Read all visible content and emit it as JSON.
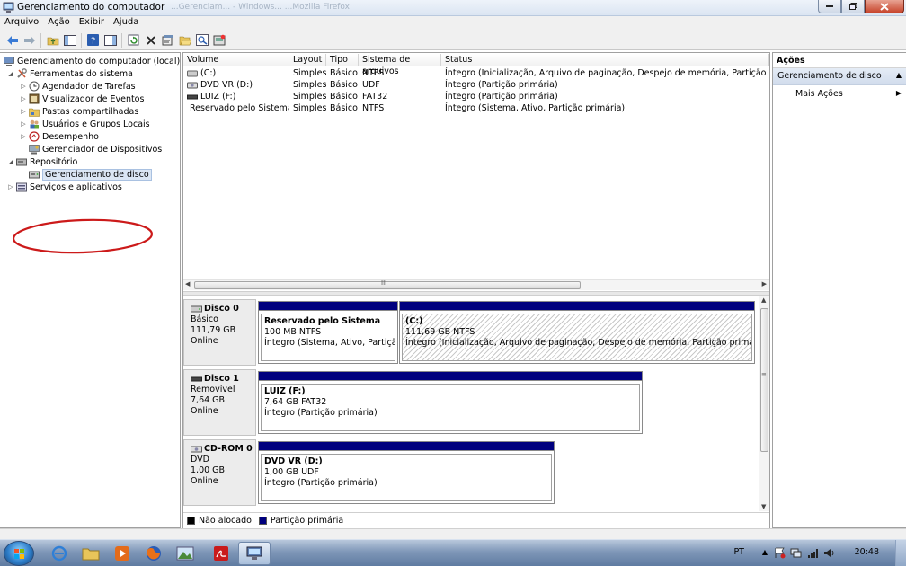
{
  "window": {
    "title": "Gerenciamento do computador",
    "ghost_title": "...Gerenciam... - Windows... ...Mozilla Firefox"
  },
  "menu": [
    "Arquivo",
    "Ação",
    "Exibir",
    "Ajuda"
  ],
  "tree": {
    "root": "Gerenciamento do computador (local)",
    "system_tools": "Ferramentas do sistema",
    "task_scheduler": "Agendador de Tarefas",
    "event_viewer": "Visualizador de Eventos",
    "shared_folders": "Pastas compartilhadas",
    "users_groups": "Usuários e Grupos Locais",
    "performance": "Desempenho",
    "device_manager": "Gerenciador de Dispositivos",
    "storage": "Repositório",
    "disk_management": "Gerenciamento de disco",
    "services_apps": "Serviços e aplicativos"
  },
  "volume_table": {
    "columns": [
      "Volume",
      "Layout",
      "Tipo",
      "Sistema de arquivos",
      "Status"
    ],
    "rows": [
      {
        "volume": "(C:)",
        "layout": "Simples",
        "tipo": "Básico",
        "fs": "NTFS",
        "status": "Íntegro (Inicialização, Arquivo de paginação, Despejo de memória, Partição primária)"
      },
      {
        "volume": "DVD VR (D:)",
        "layout": "Simples",
        "tipo": "Básico",
        "fs": "UDF",
        "status": "Íntegro (Partição primária)"
      },
      {
        "volume": "LUIZ (F:)",
        "layout": "Simples",
        "tipo": "Básico",
        "fs": "FAT32",
        "status": "Íntegro (Partição primária)"
      },
      {
        "volume": "Reservado pelo Sistema",
        "layout": "Simples",
        "tipo": "Básico",
        "fs": "NTFS",
        "status": "Íntegro (Sistema, Ativo, Partição primária)"
      }
    ]
  },
  "scroll_grip": "III",
  "disks": [
    {
      "name": "Disco 0",
      "type": "Básico",
      "size": "111,79 GB",
      "state": "Online",
      "partitions": [
        {
          "name": "Reservado pelo Sistema",
          "size": "100 MB NTFS",
          "status": "Íntegro (Sistema, Ativo, Partição pr"
        },
        {
          "name": "(C:)",
          "size": "111,69 GB NTFS",
          "status": "Íntegro (Inicialização, Arquivo de paginação, Despejo de memória, Partição primária)"
        }
      ]
    },
    {
      "name": "Disco 1",
      "type": "Removível",
      "size": "7,64 GB",
      "state": "Online",
      "partitions": [
        {
          "name": "LUIZ  (F:)",
          "size": "7,64 GB FAT32",
          "status": "Íntegro (Partição primária)"
        }
      ]
    },
    {
      "name": "CD-ROM 0",
      "type": "DVD",
      "size": "1,00 GB",
      "state": "Online",
      "partitions": [
        {
          "name": "DVD VR  (D:)",
          "size": "1,00 GB UDF",
          "status": "Íntegro (Partição primária)"
        }
      ]
    }
  ],
  "legend": {
    "unallocated": "Não alocado",
    "primary": "Partição primária"
  },
  "actions": {
    "header": "Ações",
    "section": "Gerenciamento de disco",
    "more": "Mais Ações"
  },
  "taskbar": {
    "lang": "PT",
    "clock": "20:48"
  },
  "colors": {
    "primary_partition": "#00007e",
    "unallocated": "#000000",
    "highlight_ellipse": "#cc1a1a"
  }
}
